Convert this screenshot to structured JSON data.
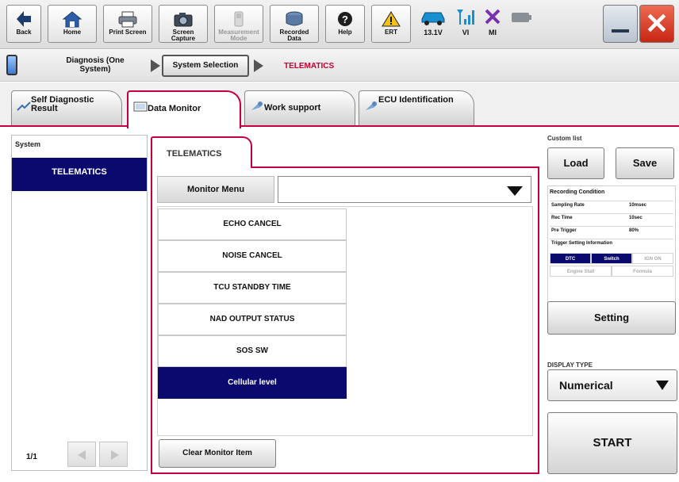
{
  "toolbar": {
    "back": "Back",
    "home": "Home",
    "print_screen": "Print Screen",
    "screen_capture": "Screen Capture",
    "measurement_mode": "Measurement Mode",
    "recorded_data": "Recorded Data",
    "help": "Help",
    "ert": "ERT",
    "voltage": "13.1V",
    "vi": "VI",
    "mi": "MI"
  },
  "breadcrumb": {
    "diagnosis": "Diagnosis (One System)",
    "system_selection": "System Selection",
    "current": "TELEMATICS"
  },
  "tabs": [
    {
      "label": "Self Diagnostic Result"
    },
    {
      "label": "Data Monitor"
    },
    {
      "label": "Work support"
    },
    {
      "label": "ECU Identification"
    }
  ],
  "left_panel": {
    "title": "System",
    "item": "TELEMATICS",
    "page": "1/1"
  },
  "center": {
    "tab": "TELEMATICS",
    "monitor_menu": "Monitor Menu",
    "monitor_menu_value": "",
    "items": [
      {
        "label": "ECHO CANCEL"
      },
      {
        "label": "NOISE CANCEL"
      },
      {
        "label": "TCU STANDBY TIME"
      },
      {
        "label": "NAD OUTPUT STATUS"
      },
      {
        "label": "SOS SW"
      },
      {
        "label": "Cellular level"
      }
    ],
    "clear_button": "Clear Monitor Item"
  },
  "right_panel": {
    "custom_list": "Custom list",
    "load": "Load",
    "save": "Save",
    "recording_condition": "Recording Condition",
    "sampling_rate_label": "Sampling Rate",
    "sampling_rate_value": "10msec",
    "rec_time_label": "Rec Time",
    "rec_time_value": "10sec",
    "pre_trigger_label": "Pre Trigger",
    "pre_trigger_value": "80%",
    "trigger_info": "Trigger Setting Information",
    "dtc": "DTC",
    "switch": "Switch",
    "ign_on": "IGN ON",
    "engine_stall": "Engine Stall",
    "formula": "Formula",
    "setting": "Setting",
    "display_type": "DISPLAY TYPE",
    "display_value": "Numerical",
    "start": "START"
  },
  "colors": {
    "accent": "#c40040",
    "selection": "#0a0a6e",
    "close": "#d3341c"
  }
}
